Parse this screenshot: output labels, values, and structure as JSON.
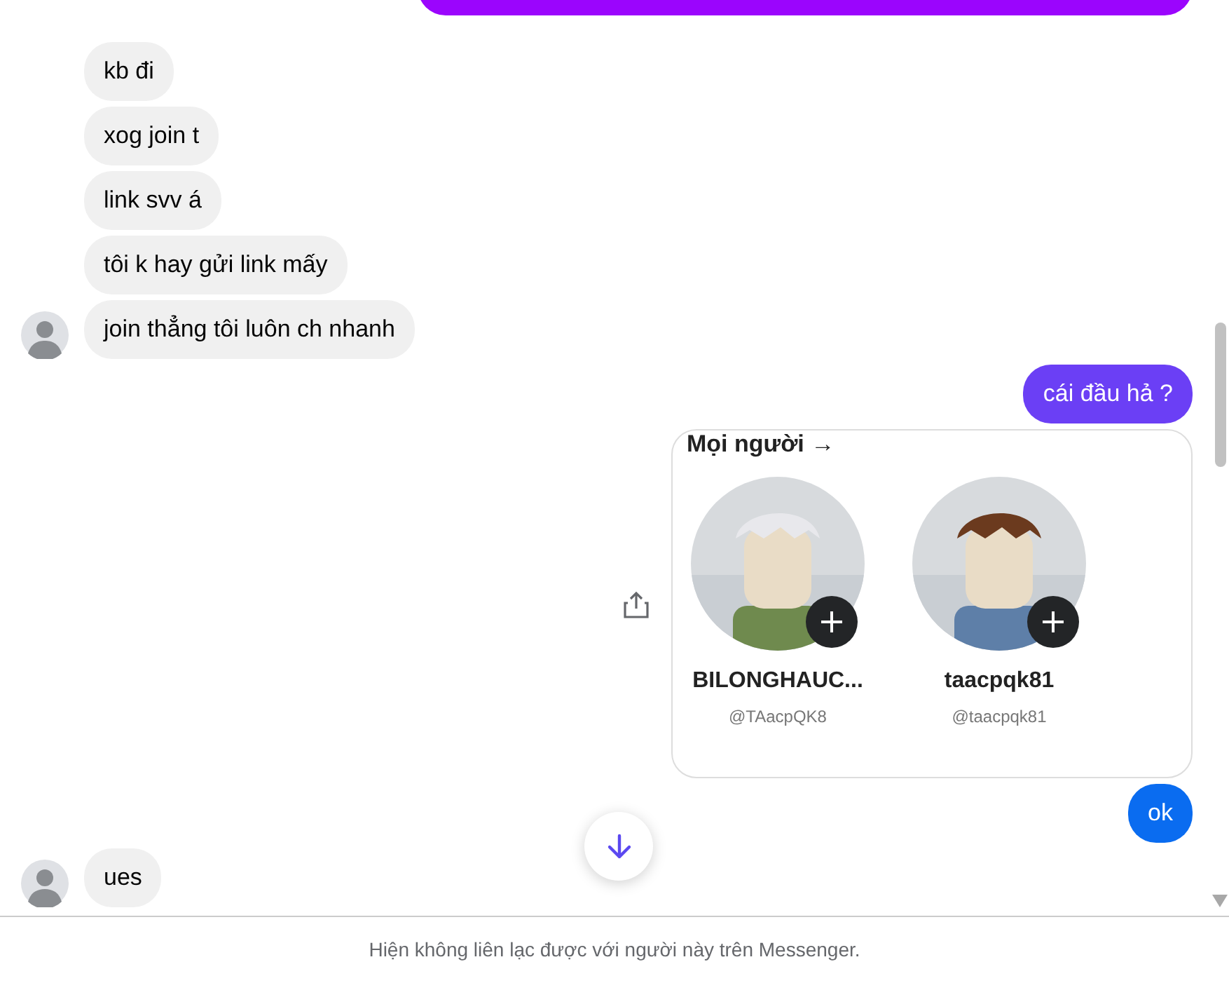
{
  "messages": [
    {
      "kind": "sent_cut",
      "color": "#9b05fd"
    },
    {
      "kind": "received",
      "text": "kb đi",
      "avatar": false
    },
    {
      "kind": "received",
      "text": "xog join t",
      "avatar": false
    },
    {
      "kind": "received",
      "text": "link svv á",
      "avatar": false
    },
    {
      "kind": "received",
      "text": "tôi k hay gửi link mấy",
      "avatar": false
    },
    {
      "kind": "received",
      "text": "join thẳng tôi luôn ch nhanh",
      "avatar": true
    },
    {
      "kind": "sent",
      "text": "cái đầu hả ?",
      "color": "#6b3ff5"
    },
    {
      "heading": "Mọi người →",
      "people": [
        {
          "name": "BILONGHAUC...",
          "handle": "@TAacpQK8"
        },
        {
          "name": "taacpqk81",
          "handle": "@taacpqk81"
        }
      ]
    },
    {
      "kind": "sent",
      "text": "ok",
      "color": "#0a6cf0"
    },
    {
      "kind": "received",
      "text": "ues",
      "avatar": true
    }
  ],
  "footer": "Hiện không liên lạc được với người này trên Messenger."
}
